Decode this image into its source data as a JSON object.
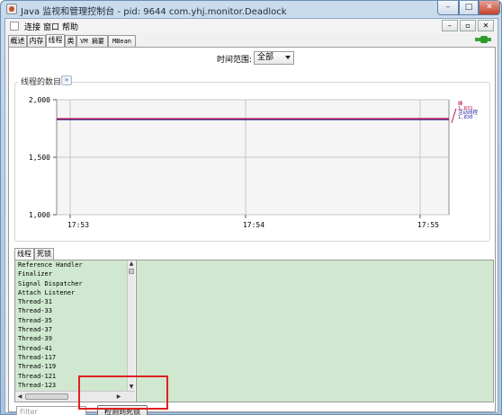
{
  "window": {
    "title": "Java 监视和管理控制台 - pid: 9644 com.yhj.monitor.Deadlock"
  },
  "window_controls": {
    "minimize": "–",
    "maximize": "□",
    "close": "✕"
  },
  "menubar": {
    "items": [
      "连接",
      "窗口",
      "帮助"
    ],
    "mdi": {
      "minimize": "–",
      "restore": "▫",
      "close": "✕"
    }
  },
  "tabs": [
    "概述",
    "内存",
    "线程",
    "类",
    "VM 摘要",
    "MBean"
  ],
  "active_tab": "线程",
  "time_range": {
    "label": "时间范围:",
    "value": "全部"
  },
  "chart_panel": {
    "title": "线程的数目",
    "collapse": "»"
  },
  "chart_data": {
    "type": "line",
    "y_ticks": [
      "2,000",
      "1,500",
      "1,000"
    ],
    "x_ticks": [
      "17:53",
      "17:54",
      "17:55"
    ],
    "ylim": [
      1000,
      2000
    ],
    "series": [
      {
        "name": "峰",
        "color": "#c01040",
        "values": [
          1830,
          1830,
          1831
        ]
      },
      {
        "name": "活动线程",
        "color": "#2a2aa0",
        "values": [
          1830,
          1830,
          1830
        ]
      }
    ],
    "legend": [
      {
        "label": "峰",
        "value": "1,831",
        "color": "#c01040"
      },
      {
        "label": "活动线程",
        "value": "1,830",
        "color": "#2a2aa0"
      }
    ]
  },
  "lower_tabs": [
    "线程",
    "死锁"
  ],
  "threads": [
    "Reference Handler",
    "Finalizer",
    "Signal Dispatcher",
    "Attach Listener",
    "Thread-31",
    "Thread-33",
    "Thread-35",
    "Thread-37",
    "Thread-39",
    "Thread-41",
    "Thread-117",
    "Thread-119",
    "Thread-121",
    "Thread-123"
  ],
  "filter": {
    "placeholder": "Filter"
  },
  "detect_button": "检测到死锁"
}
